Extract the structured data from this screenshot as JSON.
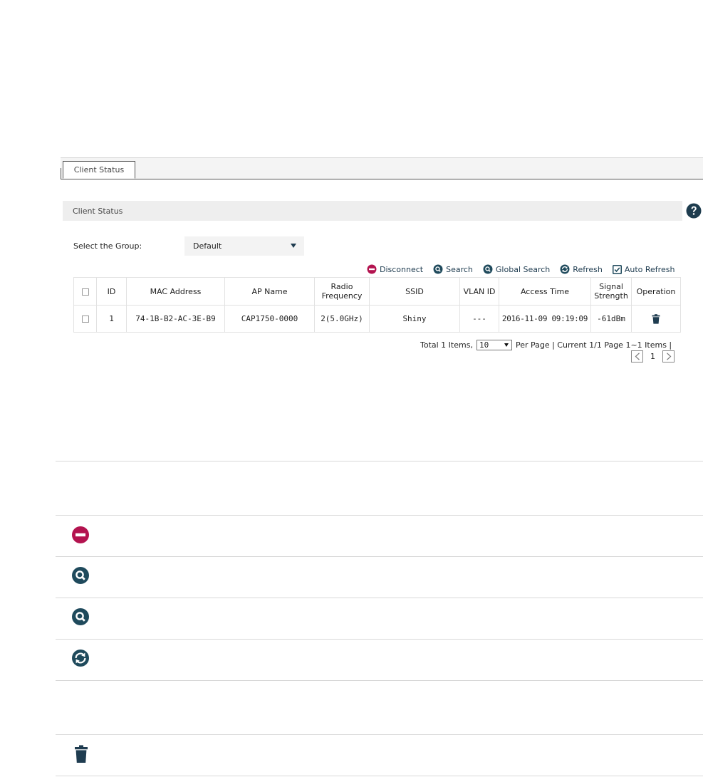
{
  "tabs": [
    {
      "label": "Client Status",
      "active": true
    }
  ],
  "section": {
    "title": "Client Status"
  },
  "group": {
    "label": "Select the Group:",
    "selected": "Default"
  },
  "toolbar": {
    "disconnect": "Disconnect",
    "search": "Search",
    "global_search": "Global Search",
    "refresh": "Refresh",
    "auto_refresh": "Auto Refresh",
    "auto_refresh_checked": true
  },
  "table": {
    "headers": [
      "ID",
      "MAC Address",
      "AP Name",
      "Radio Frequency",
      "SSID",
      "VLAN ID",
      "Access Time",
      "Signal Strength",
      "Operation"
    ],
    "rows": [
      {
        "id": "1",
        "mac": "74-1B-B2-AC-3E-B9",
        "ap_name": "CAP1750-0000",
        "radio": "2(5.0GHz)",
        "ssid": "Shiny",
        "vlan": "---",
        "access_time": "2016-11-09 09:19:09",
        "signal": "-61dBm"
      }
    ]
  },
  "pager": {
    "total": "Total 1 Items,",
    "per_page_value": "10",
    "per_page_suffix": "Per Page | Current 1/1 Page 1~1 Items |",
    "current_page": "1"
  },
  "colors": {
    "accent": "#1f4a5c",
    "danger": "#b3134f",
    "header_bg": "#eeeeee"
  },
  "icons": [
    "help-icon",
    "disconnect-icon",
    "search-icon",
    "global-search-icon",
    "refresh-icon",
    "checkbox-icon",
    "trash-icon"
  ]
}
